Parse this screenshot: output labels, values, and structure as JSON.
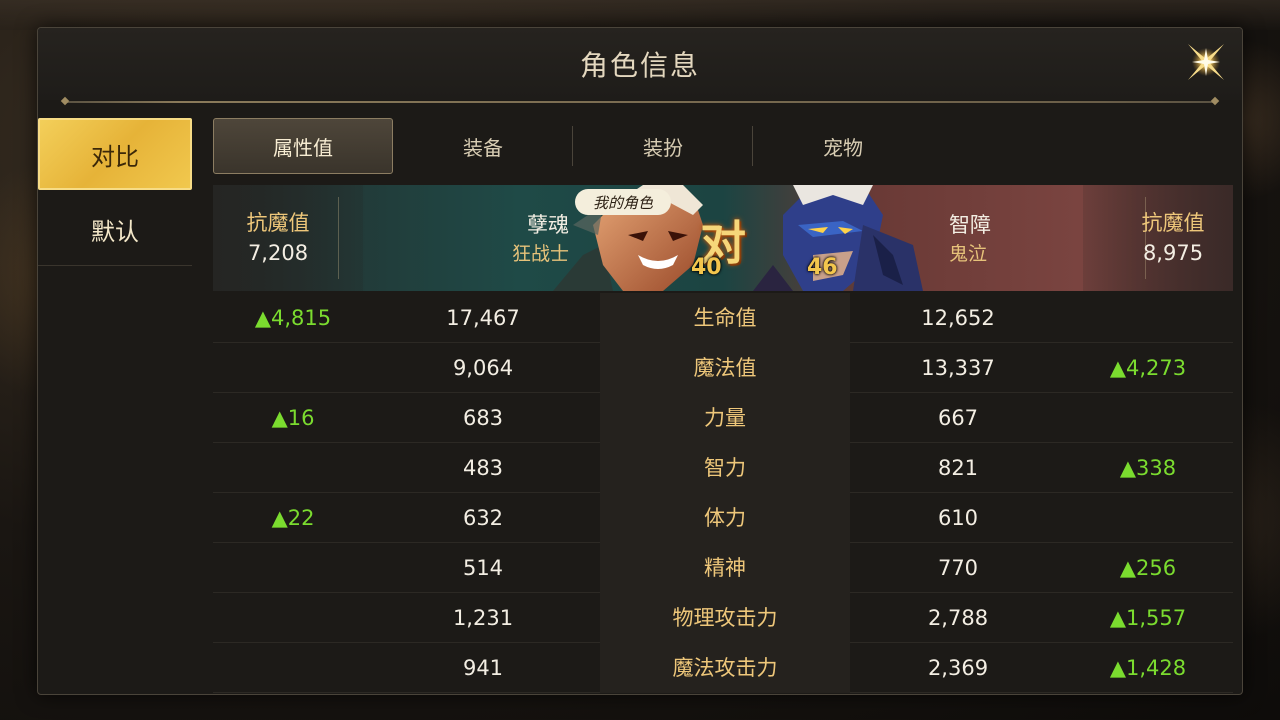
{
  "window": {
    "title": "角色信息"
  },
  "side_tabs": [
    {
      "label": "对比",
      "active": true
    },
    {
      "label": "默认",
      "active": false
    }
  ],
  "top_tabs": [
    {
      "label": "属性值",
      "active": true
    },
    {
      "label": "装备",
      "active": false
    },
    {
      "label": "装扮",
      "active": false
    },
    {
      "label": "宠物",
      "active": false
    }
  ],
  "banner": {
    "my_role_badge": "我的角色",
    "vs": "对",
    "left": {
      "stat_label": "抗魔值",
      "stat_value": "7,208",
      "name": "孽魂",
      "class": "狂战士",
      "level": "40"
    },
    "right": {
      "stat_label": "抗魔值",
      "stat_value": "8,975",
      "name": "智障",
      "class": "鬼泣",
      "level": "46"
    }
  },
  "rows": [
    {
      "name": "生命值",
      "left": "17,467",
      "right": "12,652",
      "left_diff": "▲4,815",
      "right_diff": ""
    },
    {
      "name": "魔法值",
      "left": "9,064",
      "right": "13,337",
      "left_diff": "",
      "right_diff": "▲4,273"
    },
    {
      "name": "力量",
      "left": "683",
      "right": "667",
      "left_diff": "▲16",
      "right_diff": ""
    },
    {
      "name": "智力",
      "left": "483",
      "right": "821",
      "left_diff": "",
      "right_diff": "▲338"
    },
    {
      "name": "体力",
      "left": "632",
      "right": "610",
      "left_diff": "▲22",
      "right_diff": ""
    },
    {
      "name": "精神",
      "left": "514",
      "right": "770",
      "left_diff": "",
      "right_diff": "▲256"
    },
    {
      "name": "物理攻击力",
      "left": "1,231",
      "right": "2,788",
      "left_diff": "",
      "right_diff": "▲1,557"
    },
    {
      "name": "魔法攻击力",
      "left": "941",
      "right": "2,369",
      "left_diff": "",
      "right_diff": "▲1,428"
    }
  ],
  "colors": {
    "accent_gold": "#f3cf5a",
    "positive_diff": "#7bdc2f",
    "stat_label": "#eec77a"
  }
}
